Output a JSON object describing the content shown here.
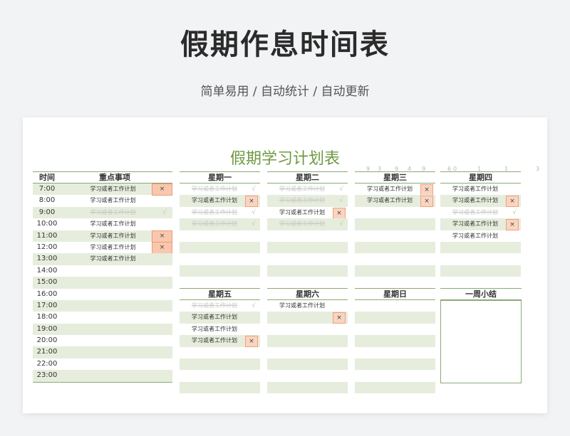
{
  "hero": {
    "title": "假期作息时间表",
    "subtitle": "简单易用 / 自动统计 / 自动更新"
  },
  "sheet": {
    "title": "假期学习计划表",
    "faint_text": [
      "9",
      "3",
      "9",
      "4",
      "9",
      "6",
      "0",
      "1",
      "1",
      "3"
    ],
    "time_col": {
      "header_time": "时间",
      "header_task": "重点事项"
    },
    "times": [
      {
        "time": "7:00",
        "task": "学习或者工作计划",
        "status": "x"
      },
      {
        "time": "8:00",
        "task": "学习或者工作计划",
        "status": ""
      },
      {
        "time": "9:00",
        "task": "学习或者工作计划",
        "status": "done"
      },
      {
        "time": "10:00",
        "task": "学习或者工作计划",
        "status": ""
      },
      {
        "time": "11:00",
        "task": "学习或者工作计划",
        "status": "x"
      },
      {
        "time": "12:00",
        "task": "学习或者工作计划",
        "status": "x"
      },
      {
        "time": "13:00",
        "task": "学习或者工作计划",
        "status": ""
      },
      {
        "time": "14:00",
        "task": "",
        "status": ""
      },
      {
        "time": "15:00",
        "task": "",
        "status": ""
      },
      {
        "time": "16:00",
        "task": "",
        "status": ""
      },
      {
        "time": "17:00",
        "task": "",
        "status": ""
      },
      {
        "time": "18:00",
        "task": "",
        "status": ""
      },
      {
        "time": "19:00",
        "task": "",
        "status": ""
      },
      {
        "time": "20:00",
        "task": "",
        "status": ""
      },
      {
        "time": "21:00",
        "task": "",
        "status": ""
      },
      {
        "time": "22:00",
        "task": "",
        "status": ""
      },
      {
        "time": "23:00",
        "task": "",
        "status": ""
      }
    ],
    "days_top": [
      {
        "name": "星期一",
        "tasks": [
          {
            "text": "学习或者工作计划",
            "status": "done"
          },
          {
            "text": "学习或者工作计划",
            "status": "x"
          },
          {
            "text": "学习或者工作计划",
            "status": "done"
          },
          {
            "text": "学习或者工作计划",
            "status": "done"
          }
        ]
      },
      {
        "name": "星期二",
        "tasks": [
          {
            "text": "学习或者工作计划",
            "status": "done"
          },
          {
            "text": "学习或者工作计划",
            "status": "done"
          },
          {
            "text": "学习或者工作计划",
            "status": "x"
          },
          {
            "text": "学习或者工作计划",
            "status": "done"
          }
        ]
      },
      {
        "name": "星期三",
        "tasks": [
          {
            "text": "学习或者工作计划",
            "status": "x"
          },
          {
            "text": "学习或者工作计划",
            "status": "x"
          }
        ]
      },
      {
        "name": "星期四",
        "tasks": [
          {
            "text": "学习或者工作计划",
            "status": ""
          },
          {
            "text": "学习或者工作计划",
            "status": "x"
          },
          {
            "text": "学习或者工作计划",
            "status": "done"
          },
          {
            "text": "学习或者工作计划",
            "status": "x"
          },
          {
            "text": "学习或者工作计划",
            "status": ""
          }
        ]
      }
    ],
    "days_bottom": [
      {
        "name": "星期五",
        "tasks": [
          {
            "text": "学习或者工作计划",
            "status": "done"
          },
          {
            "text": "学习或者工作计划",
            "status": ""
          },
          {
            "text": "学习或者工作计划",
            "status": ""
          },
          {
            "text": "学习或者工作计划",
            "status": "x"
          }
        ]
      },
      {
        "name": "星期六",
        "tasks": [
          {
            "text": "学习或者工作计划",
            "status": ""
          },
          {
            "text": "",
            "status": "x"
          }
        ]
      },
      {
        "name": "星期日",
        "tasks": []
      }
    ],
    "summary_label": "一周小结",
    "mark_x": "×",
    "mark_check": "√"
  }
}
